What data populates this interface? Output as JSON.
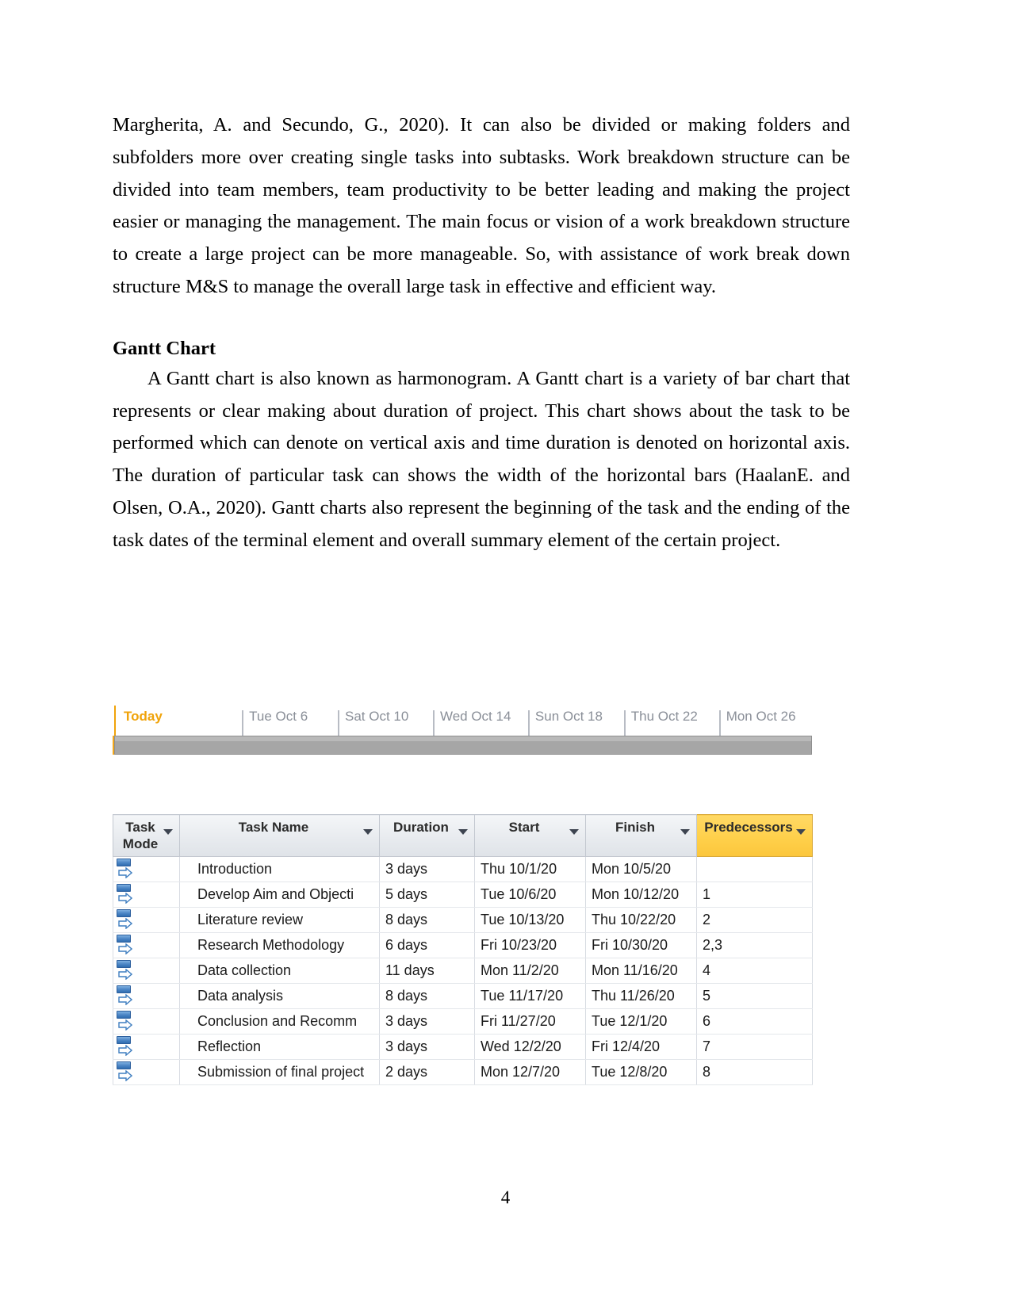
{
  "document": {
    "page_number": "4",
    "paragraphs": [
      {
        "id": "wbs_paragraph",
        "text": "Margherita, A. and Secundo, G., 2020). It can also be divided or making folders and subfolders more over creating single tasks into subtasks. Work breakdown structure can be divided into team members, team productivity to be better leading and making the project easier or managing the management. The main focus or vision of a work breakdown structure to create a large project can be more manageable. So, with assistance of work break down structure M&S to manage the overall large task in effective and efficient way."
      },
      {
        "id": "gantt_paragraph",
        "text": "A Gantt chart is also known as harmonogram. A Gantt chart is a variety of bar chart that represents or clear making about duration of project. This chart shows about the task to be performed which can denote on vertical axis and time duration is denoted on horizontal axis. The duration of particular task can shows the width of the horizontal bars (HaalanE. and Olsen, O.A., 2020). Gantt charts also represent the beginning of the task and the ending of the task dates of the terminal element and overall summary element of the certain project."
      }
    ],
    "heading": {
      "gantt_chart": "Gantt Chart"
    }
  },
  "colors": {
    "today_marker": "#f0a30a",
    "timeline_bar": "#a6a6a6",
    "timeline_label": "#8a8f98",
    "predecessors_header": "#ffd04a",
    "header_gradient_top": "#f4f6f8",
    "task_mode_icon": "#2f6cb0"
  },
  "gantt": {
    "timeline": {
      "today_label": "Today",
      "ticks": [
        {
          "label": "Tue Oct 6",
          "left_pct": 18.5
        },
        {
          "label": "Sat Oct 10",
          "left_pct": 32.2
        },
        {
          "label": "Wed Oct 14",
          "left_pct": 45.8
        },
        {
          "label": "Sun Oct 18",
          "left_pct": 59.4
        },
        {
          "label": "Thu Oct 22",
          "left_pct": 73.1
        },
        {
          "label": "Mon Oct 26",
          "left_pct": 86.7
        }
      ]
    },
    "table": {
      "columns": [
        {
          "key": "task_mode",
          "label": "Task\nMode",
          "highlight": false
        },
        {
          "key": "task_name",
          "label": "Task Name",
          "highlight": false
        },
        {
          "key": "duration",
          "label": "Duration",
          "highlight": false
        },
        {
          "key": "start",
          "label": "Start",
          "highlight": false
        },
        {
          "key": "finish",
          "label": "Finish",
          "highlight": false
        },
        {
          "key": "predecessors",
          "label": "Predecessors",
          "highlight": true
        }
      ],
      "rows": [
        {
          "mode_icon": "auto-scheduled-icon",
          "task_name": "Introduction",
          "duration": "3 days",
          "start": "Thu 10/1/20",
          "finish": "Mon 10/5/20",
          "predecessors": ""
        },
        {
          "mode_icon": "auto-scheduled-icon",
          "task_name": "Develop Aim and Objecti",
          "duration": "5 days",
          "start": "Tue 10/6/20",
          "finish": "Mon 10/12/20",
          "predecessors": "1"
        },
        {
          "mode_icon": "auto-scheduled-icon",
          "task_name": "Literature review",
          "duration": "8 days",
          "start": "Tue 10/13/20",
          "finish": "Thu 10/22/20",
          "predecessors": "2"
        },
        {
          "mode_icon": "auto-scheduled-icon",
          "task_name": "Research Methodology",
          "duration": "6 days",
          "start": "Fri 10/23/20",
          "finish": "Fri 10/30/20",
          "predecessors": "2,3"
        },
        {
          "mode_icon": "auto-scheduled-icon",
          "task_name": "Data collection",
          "duration": "11 days",
          "start": "Mon 11/2/20",
          "finish": "Mon 11/16/20",
          "predecessors": "4"
        },
        {
          "mode_icon": "auto-scheduled-icon",
          "task_name": "Data analysis",
          "duration": "8 days",
          "start": "Tue 11/17/20",
          "finish": "Thu 11/26/20",
          "predecessors": "5"
        },
        {
          "mode_icon": "auto-scheduled-icon",
          "task_name": "Conclusion and Recomm",
          "duration": "3 days",
          "start": "Fri 11/27/20",
          "finish": "Tue 12/1/20",
          "predecessors": "6"
        },
        {
          "mode_icon": "auto-scheduled-icon",
          "task_name": "Reflection",
          "duration": "3 days",
          "start": "Wed 12/2/20",
          "finish": "Fri 12/4/20",
          "predecessors": "7"
        },
        {
          "mode_icon": "auto-scheduled-icon",
          "task_name": "Submission of final project",
          "duration": "2 days",
          "start": "Mon 12/7/20",
          "finish": "Tue 12/8/20",
          "predecessors": "8"
        }
      ]
    }
  }
}
